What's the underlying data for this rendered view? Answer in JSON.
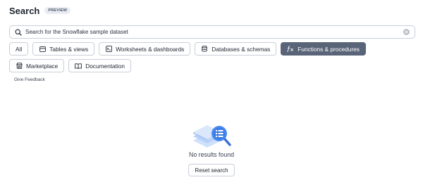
{
  "header": {
    "title": "Search",
    "badge": "PREVIEW"
  },
  "search": {
    "placeholder": "Search for the Snowflake sample dataset",
    "search_icon": "search-icon",
    "clear_icon": "clear-icon"
  },
  "filters": [
    {
      "label": "All",
      "icon": "",
      "active": false
    },
    {
      "label": "Tables & views",
      "icon": "table-icon",
      "active": false
    },
    {
      "label": "Worksheets & dashboards",
      "icon": "worksheet-icon",
      "active": false
    },
    {
      "label": "Databases & schemas",
      "icon": "database-icon",
      "active": false
    },
    {
      "label": "Functions & procedures",
      "icon": "function-icon",
      "active": true
    },
    {
      "label": "Marketplace",
      "icon": "marketplace-icon",
      "active": false
    },
    {
      "label": "Documentation",
      "icon": "book-icon",
      "active": false
    }
  ],
  "feedback": {
    "label": "Give Feedback"
  },
  "empty_state": {
    "message": "No results found",
    "reset_label": "Reset search",
    "illustration": "no-results-illustration"
  },
  "colors": {
    "active_chip": "#5a6478",
    "accent_blue": "#3b82f6",
    "border": "#c9ced8"
  }
}
